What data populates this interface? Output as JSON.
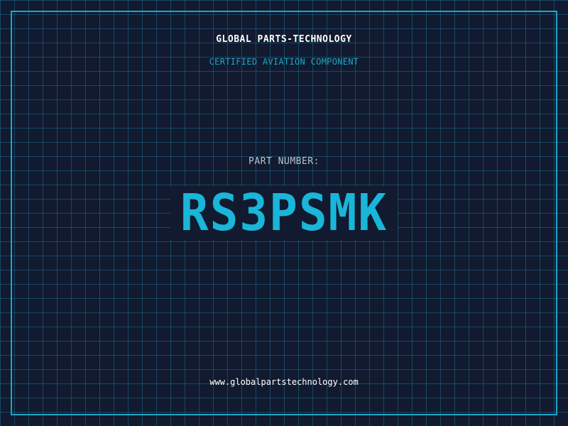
{
  "header": {
    "company": "GLOBAL PARTS-TECHNOLOGY",
    "subtitle": "CERTIFIED AVIATION COMPONENT"
  },
  "part": {
    "label": "PART NUMBER:",
    "number": "RS3PSMK"
  },
  "footer": {
    "url": "www.globalpartstechnology.com"
  },
  "colors": {
    "background": "#111a2f",
    "accent": "#1ca7c7",
    "grid": "#1e6e8c",
    "text": "#ffffff",
    "label": "#b9c2cf"
  }
}
